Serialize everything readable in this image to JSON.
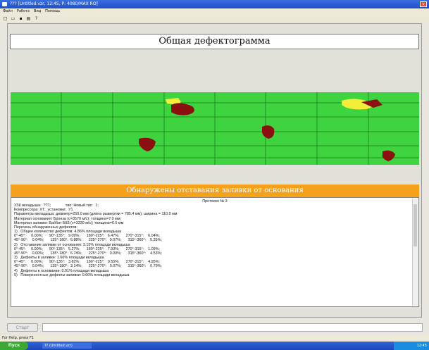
{
  "window": {
    "title": "??? [Untitled.vzr, 12:45, P: 4080/MAX RO]"
  },
  "menu": [
    "Файл",
    "Работа",
    "Вид",
    "Помощь"
  ],
  "toolbar": {
    "icons": [
      "new-icon",
      "open-icon",
      "save-icon",
      "print-icon",
      "help-icon"
    ]
  },
  "page": {
    "title": "Общая дефектограмма",
    "section_heading": "Обнаружены отставания заливки от основания"
  },
  "defectogram": {
    "background": "#3fd43f",
    "grid_color": "#1a7a1a",
    "defect_color": "#8b1010",
    "highlight_color": "#f2ee3a"
  },
  "report": {
    "lines": [
      "Протокол № 3",
      "УЗК вкладыша:  ???;              тип: Новый тип   1;",
      "Компрессора: ХТ;  установки:  У1",
      "Параметры вкладыша: диаметр=250.0 мм (длина развертки = 785.4 мм); ширина = 110.0 мм",
      "Материал основания: Бронза (c=3570 м/с); толщина=7.0 мм;",
      "Материал заливки: Баббит Б83 (c=3330 м/с); толщина=6.0 мм",
      "Перечень обнаруженных дефектов:",
      "1)   Общее количество дефектов: 4.86% площади вкладыша",
      "0°-45°:     0.00%;      90°-135°:   9.09%;      180°-225°:   6.47%;      270°-315°:    6.04%;",
      "45°-90°:    0.04%;      135°-180°:  6.88%;      225°-270°:   0.07%;      315°-360°:    5.35%;",
      "2)   Отставание заливки от основания: 3.15% площади вкладыша",
      "0°-45°:     0.00%;      90°-135°:   5.27%;      180°-225°:   7.93%;      270°-315°:    1.09%;",
      "45°-90°:    0.00%;      135°-180°:  6.74%;      225°-270°:   0.00%;      315°-360°:    4.53%;",
      "3)   Дефекты в заливке: 1.66% площади вкладыша",
      "0°-45°:     0.00%;      90°-135°:   3.82%;      180°-225°:   0.55%;      270°-315°:    4.95%;",
      "45°-90°:    0.04%;      135°-180°:  3.14%;      225°-270°:   0.07%;      315°-360°:    0.79%;",
      "4)   Дефекты в основании: 0.01% площади вкладыша",
      "5)   Поверхностные дефекты заливки: 0.00% площади вкладыша"
    ]
  },
  "bottom": {
    "start_button": "Старт",
    "command_value": ""
  },
  "statusbar": {
    "text": "For Help, press F1"
  },
  "taskbar": {
    "start": "Пуск",
    "app": "?? (Untitled.vzr)",
    "tray": "12:45"
  }
}
